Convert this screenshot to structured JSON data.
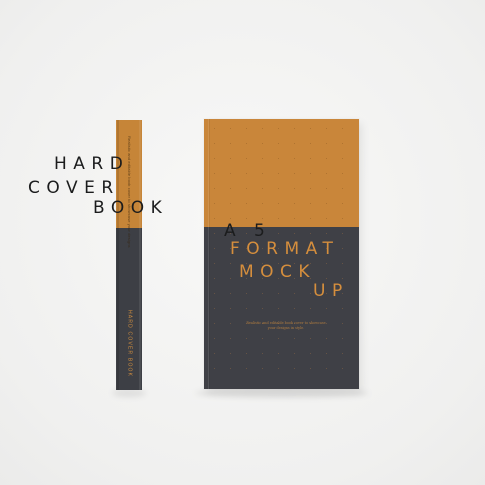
{
  "book": {
    "spine_title": "HARD COVER BOOK",
    "spine_blurb": "Realistic and editable book cover to showcase your designs",
    "title_lines": [
      "HARD",
      "COVER",
      "BOOK",
      "A 5",
      "FORMAT",
      "MOCK",
      "UP"
    ],
    "cover_blurb": "Realistic and editable book cover to showcase your designs in style."
  },
  "colors": {
    "background": "#f3f3f2",
    "orange": "#c9863a",
    "charcoal": "#3f4046",
    "dark_text": "#1b1c1d",
    "orange_text": "#d58e3d"
  }
}
